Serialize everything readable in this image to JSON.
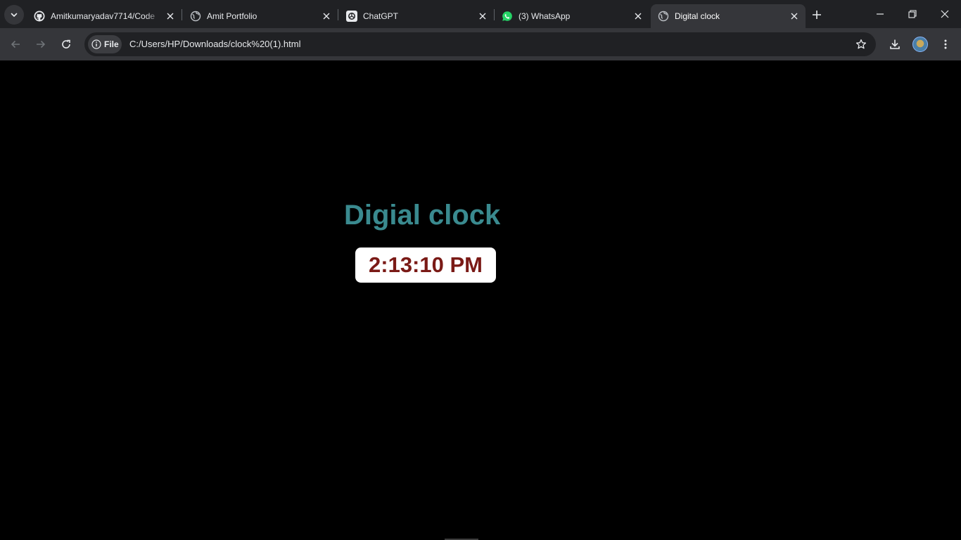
{
  "browser": {
    "tabs": [
      {
        "title": "Amitkumaryadav7714/Code",
        "icon": "github-icon",
        "active": false
      },
      {
        "title": "Amit Portfolio",
        "icon": "globe-icon",
        "active": false
      },
      {
        "title": "ChatGPT",
        "icon": "chatgpt-icon",
        "active": false
      },
      {
        "title": "(3) WhatsApp",
        "icon": "whatsapp-icon",
        "active": false
      },
      {
        "title": "Digital clock",
        "icon": "globe-icon",
        "active": true
      }
    ],
    "omnibox": {
      "chip_label": "File",
      "url": "C:/Users/HP/Downloads/clock%20(1).html"
    },
    "colors": {
      "tabstrip": "#202124",
      "toolbar": "#35363a",
      "whatsapp": "#25d366"
    }
  },
  "page": {
    "heading": "Digial clock",
    "time": "2:13:10 PM",
    "colors": {
      "background": "#000000",
      "heading": "#3a8a8f",
      "time": "#7a1a16",
      "time_box": "#ffffff"
    }
  }
}
